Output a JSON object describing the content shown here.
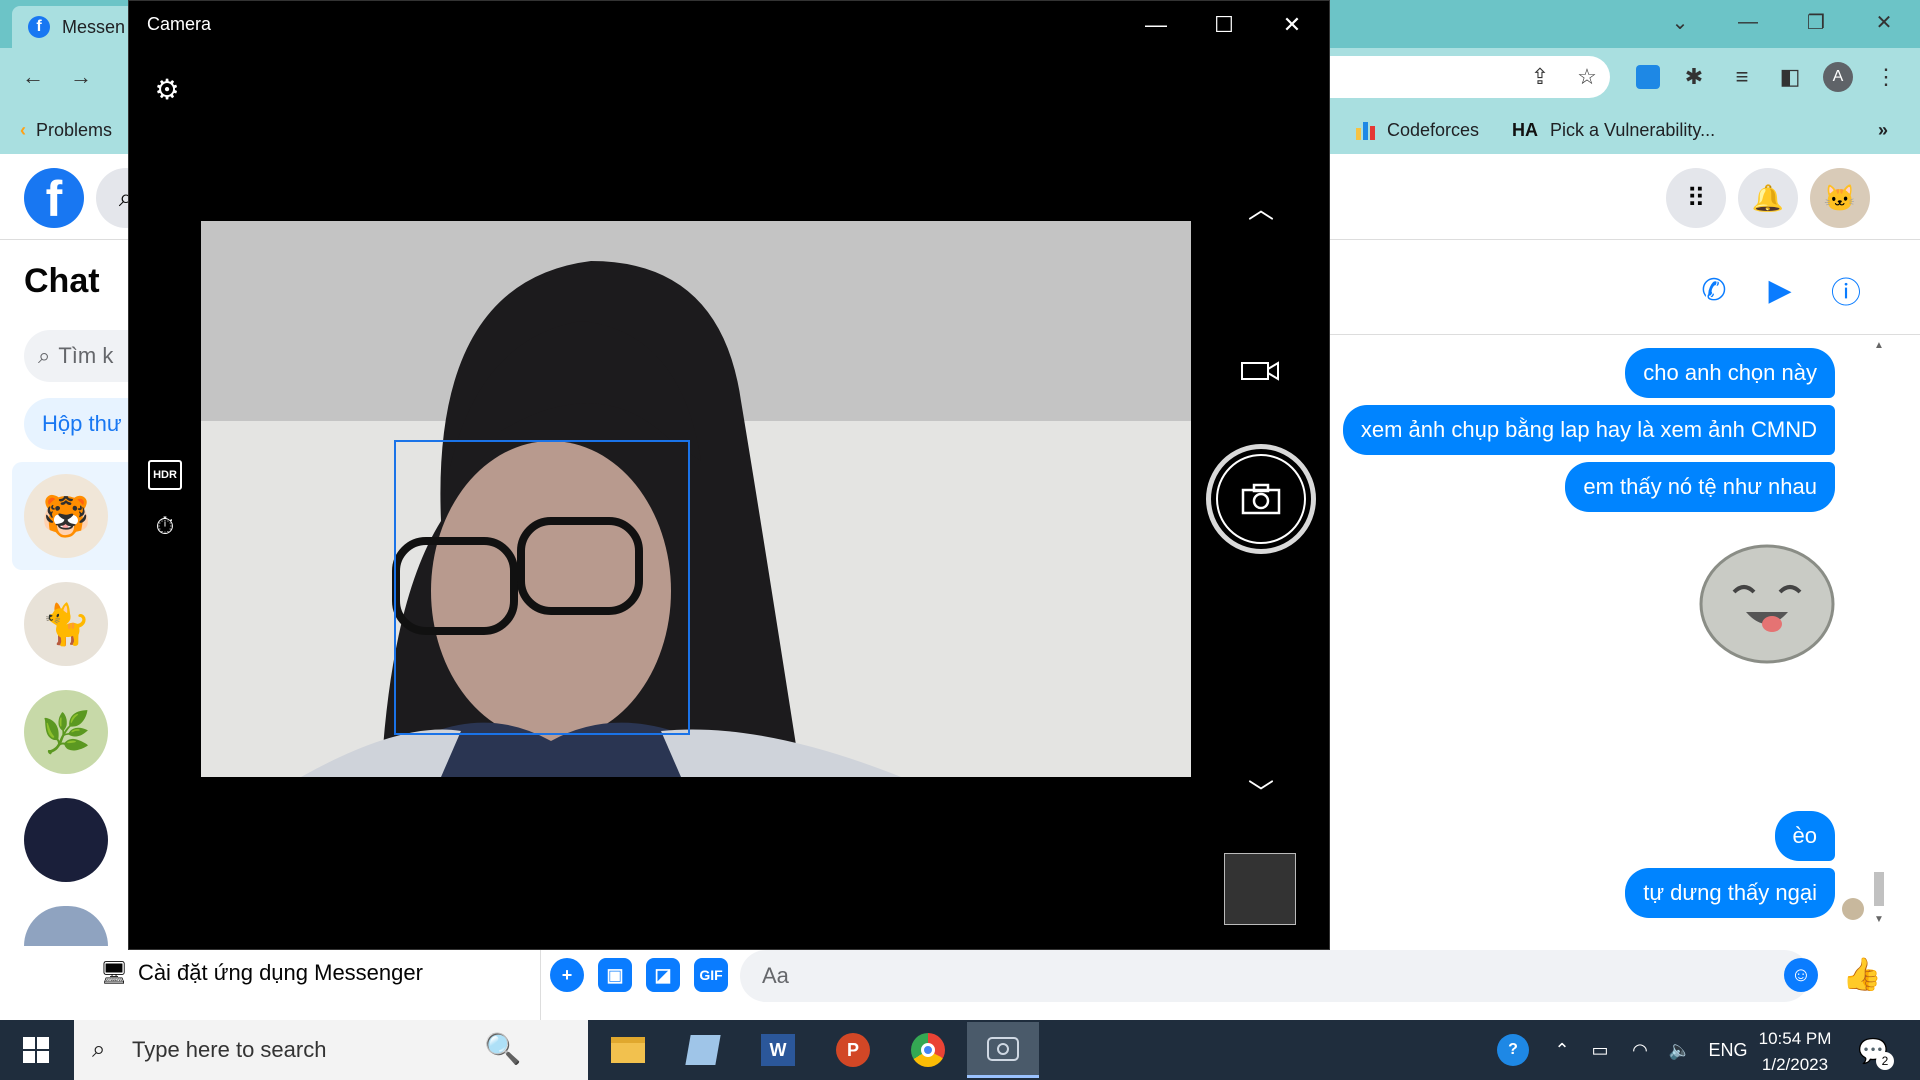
{
  "browser": {
    "tab_title": "Messen",
    "tab_favicon_letter": "f",
    "bookmarks": [
      {
        "label": "Problems"
      },
      {
        "label": "Codeforces"
      },
      {
        "label": "Pick a Vulnerability..."
      }
    ],
    "profile_letter": "A",
    "bookmark_overflow": "»"
  },
  "facebook": {
    "chat_title": "Chat",
    "search_placeholder": "Tìm k",
    "inbox_pill": "Hộp thư",
    "install_app": "Cài đặt ứng dụng Messenger",
    "composer_placeholder": "Aa",
    "gif_label": "GIF",
    "messages": [
      {
        "text": "cho anh chọn này"
      },
      {
        "text": "xem ảnh chụp bằng lap hay là xem ảnh CMND"
      },
      {
        "text": "em thấy nó tệ như nhau"
      },
      {
        "text": "èo"
      },
      {
        "text": "tự dưng thấy ngại"
      }
    ],
    "accent_color": "#0084ff"
  },
  "camera": {
    "window_title": "Camera"
  },
  "taskbar": {
    "search_placeholder": "Type here to search",
    "language": "ENG",
    "time": "10:54 PM",
    "date": "1/2/2023",
    "notification_count": "2"
  }
}
